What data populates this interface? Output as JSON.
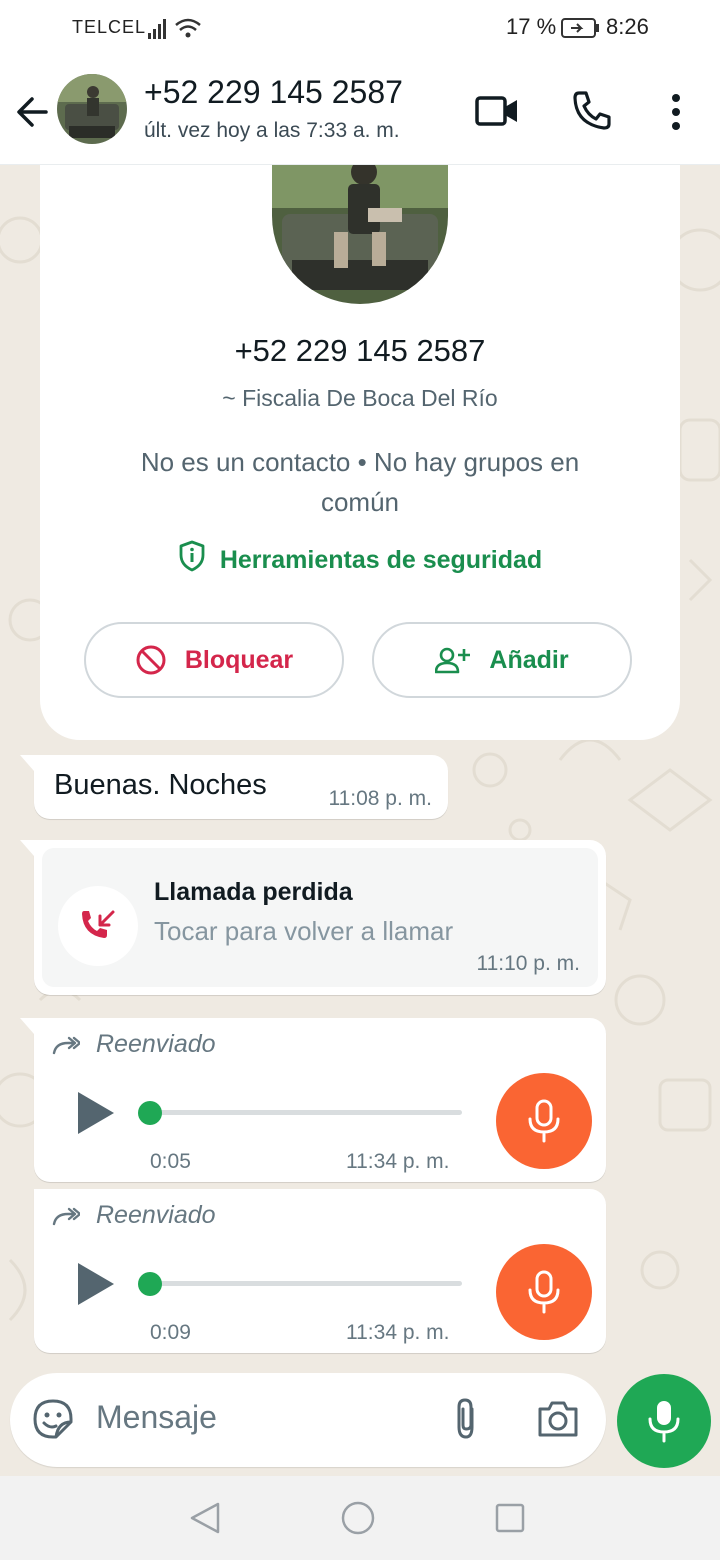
{
  "status_bar": {
    "carrier": "TELCEL",
    "battery_percent": "17 %",
    "time": "8:26"
  },
  "header": {
    "title": "+52 229 145 2587",
    "subtitle": "últ. vez hoy a las 7:33 a. m.",
    "icons": [
      "arrow-left-icon",
      "video-call-icon",
      "phone-icon",
      "more-vert-icon"
    ]
  },
  "info_card": {
    "phone": "+52 229 145 2587",
    "name": "~ Fiscalia De Boca Del Río",
    "note": "No es un contacto • No hay grupos en común",
    "safety_tools": "Herramientas de seguridad",
    "block_label": "Bloquear",
    "add_label": "Añadir"
  },
  "messages": [
    {
      "type": "text",
      "text": "Buenas. Noches",
      "time": "11:08 p. m."
    },
    {
      "type": "missed_call",
      "title": "Llamada perdida",
      "subtitle": "Tocar para volver a llamar",
      "time": "11:10 p. m."
    },
    {
      "type": "voice",
      "forwarded_label": "Reenviado",
      "duration": "0:05",
      "time": "11:34 p. m.",
      "progress": 0
    },
    {
      "type": "voice",
      "forwarded_label": "Reenviado",
      "duration": "0:09",
      "time": "11:34 p. m.",
      "progress": 0
    }
  ],
  "input_bar": {
    "placeholder": "Mensaje"
  },
  "colors": {
    "accent_green": "#1fa855",
    "danger_red": "#d4264b",
    "voice_orange": "#fa6533",
    "chat_background": "#efeae2"
  }
}
